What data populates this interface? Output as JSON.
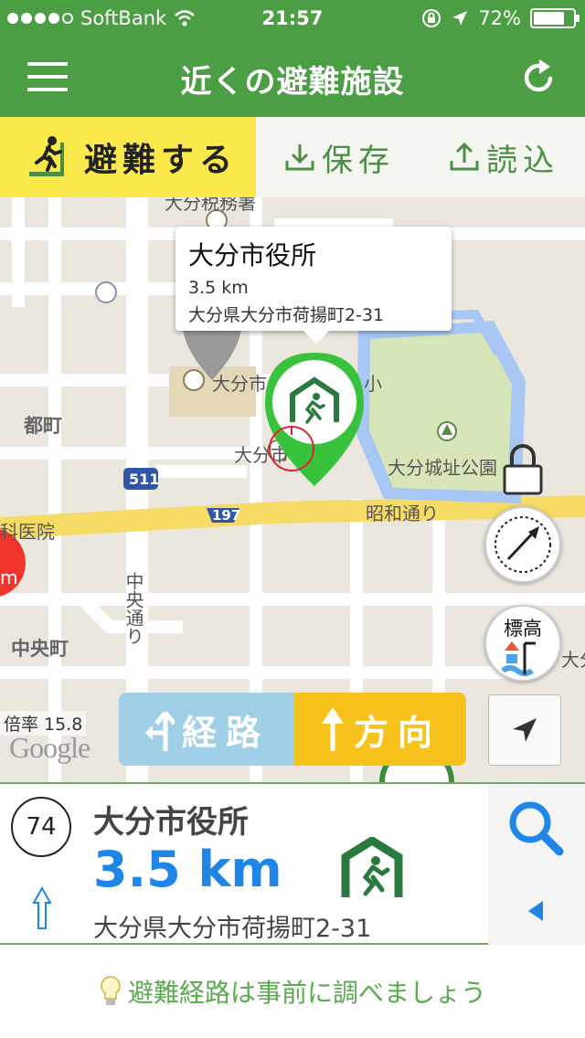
{
  "status_bar": {
    "carrier": "SoftBank",
    "time": "21:57",
    "battery": "72%",
    "battery_level": 0.72
  },
  "navbar": {
    "title": "近くの避難施設"
  },
  "actions": {
    "evacuate_label": "避難する",
    "save_label": "保存",
    "load_label": "読込"
  },
  "map": {
    "labels": {
      "tax_office": "大分税務署",
      "tocho": "都町",
      "hospital": "科医院",
      "central_town": "中央町",
      "castle_park": "大分城址公園",
      "showa_street": "昭和通り",
      "chuo_street": "中央通り",
      "oita_city": "大分市",
      "oita_school": "大分市",
      "school_suffix": "小",
      "route_511": "511",
      "route_197": "197",
      "edge_label": "大分",
      "partial_m": "m"
    },
    "scale_label": "倍率 15.8",
    "attribution": "Google",
    "popup": {
      "title": "大分市役所",
      "distance": "3.5 km",
      "address": "大分県大分市荷揚町2-31"
    },
    "elevation_label": "標高",
    "route_button": "経路",
    "direction_button": "方向"
  },
  "info": {
    "count": "74",
    "title": "大分市役所",
    "distance": "3.5 km",
    "address": "大分県大分市荷揚町2-31"
  },
  "tip": "避難経路は事前に調べましょう",
  "colors": {
    "brand_green": "#4b9e44",
    "evac_yellow": "#fbe84b",
    "distance_blue": "#1f86e8",
    "route_blue": "#9fd0e8",
    "direction_yellow": "#f6c21b"
  }
}
